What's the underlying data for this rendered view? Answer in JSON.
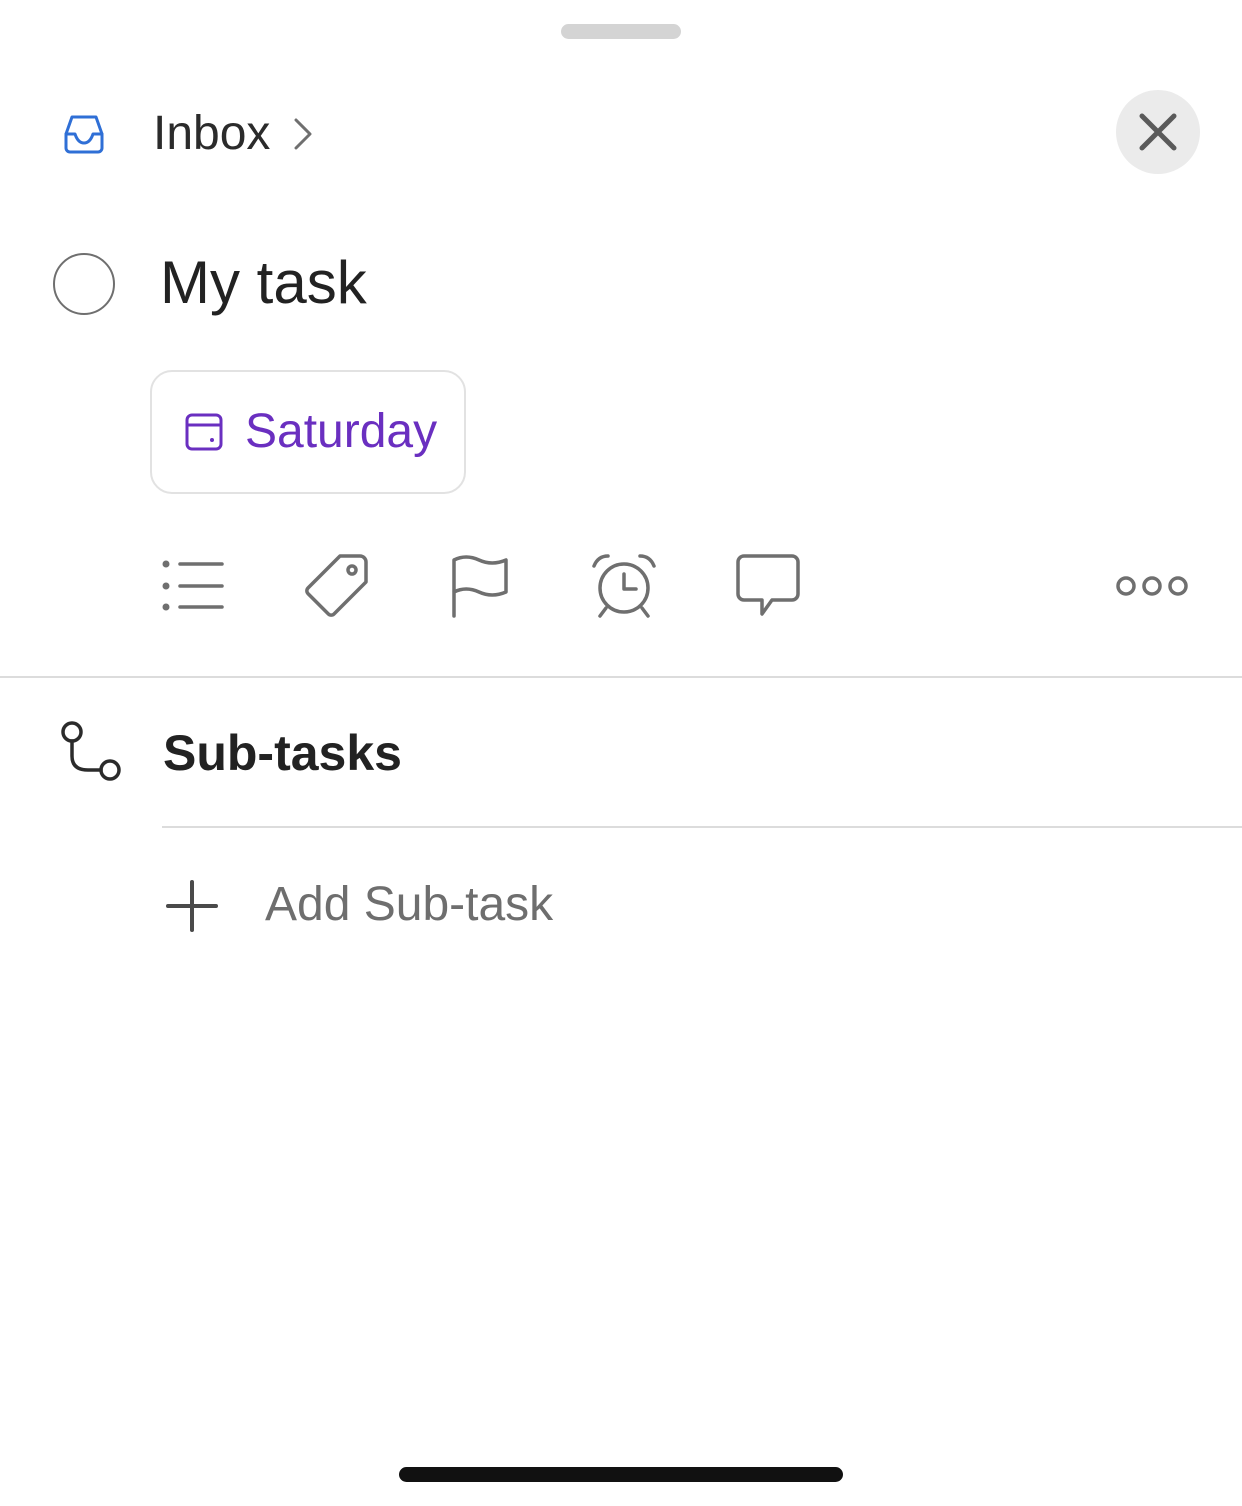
{
  "header": {
    "project_label": "Inbox",
    "project_icon": "inbox-icon",
    "chevron_icon": "chevron-right-icon",
    "close_icon": "close-icon"
  },
  "task": {
    "title": "My task",
    "completed": false
  },
  "date_chip": {
    "label": "Saturday",
    "icon": "calendar-icon",
    "color": "#6a2fc0"
  },
  "actions": [
    {
      "name": "description-list-icon"
    },
    {
      "name": "tag-icon"
    },
    {
      "name": "flag-icon"
    },
    {
      "name": "alarm-clock-icon"
    },
    {
      "name": "comment-icon"
    },
    {
      "name": "more-icon"
    }
  ],
  "subtasks": {
    "title": "Sub-tasks",
    "icon": "subtasks-icon",
    "add_label": "Add Sub-task"
  },
  "colors": {
    "inbox_blue": "#2f6fd6",
    "date_purple": "#6a2fc0",
    "icon_gray": "#6f6f6f"
  }
}
